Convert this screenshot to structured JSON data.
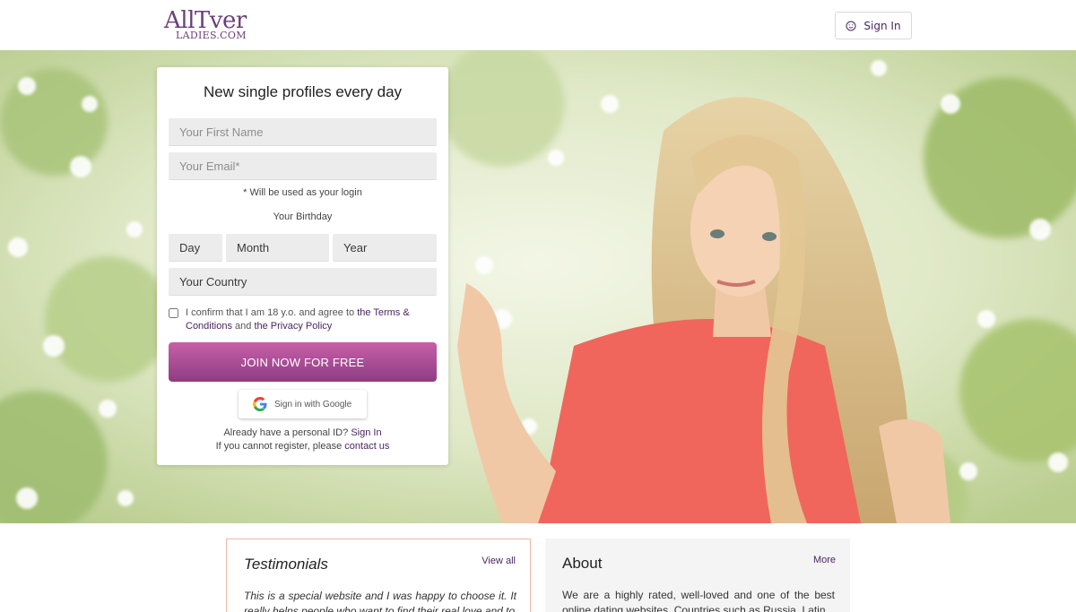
{
  "header": {
    "logo_top": "AllTver",
    "logo_bottom": "LADIES.COM",
    "signin_label": "Sign In"
  },
  "form": {
    "title": "New single profiles every day",
    "first_name_placeholder": "Your First Name",
    "email_placeholder": "Your Email*",
    "email_note": "* Will be used as your login",
    "birthday_label": "Your Birthday",
    "day": "Day",
    "month": "Month",
    "year": "Year",
    "country": "Your Country",
    "agree_prefix": "I confirm that I am 18 y.o. and agree to ",
    "terms_link": "the Terms & Conditions",
    "agree_and": " and ",
    "privacy_link": "the Privacy Policy",
    "join_label": "JOIN NOW FOR FREE",
    "google_label": "Sign in with Google",
    "already_text": "Already have a personal ID? ",
    "signin_link": "Sign In",
    "cannot_text": "If you cannot register, please ",
    "contact_link": "contact us"
  },
  "testimonials": {
    "title": "Testimonials",
    "link": "View all",
    "text": "This is a special website and I was happy to choose it. It really helps people who want to find their real love and to"
  },
  "about": {
    "title": "About",
    "link": "More",
    "text": "We are a highly rated, well-loved and one of the best online dating websites. Countries such as Russia, Latin"
  },
  "colors": {
    "brand": "#6b3f7a",
    "link": "#4a2560",
    "join_top": "#c75fa8",
    "join_bottom": "#8e3d83"
  },
  "icons": {
    "signin": "smile-icon",
    "google": "google-g-icon"
  }
}
